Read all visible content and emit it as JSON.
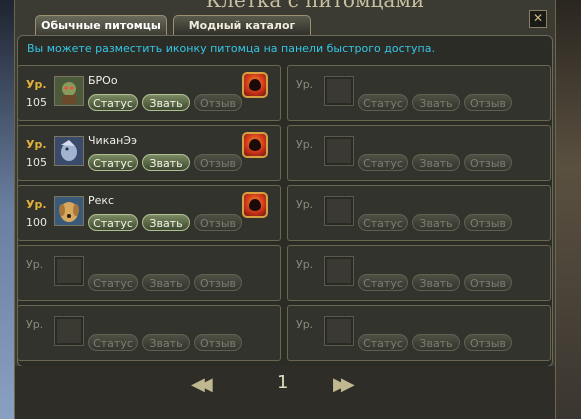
{
  "window": {
    "title": "Клетка с питомцами",
    "close_icon": "close-icon"
  },
  "tabs": [
    {
      "label": "Обычные питомцы",
      "active": true
    },
    {
      "label": "Модный каталог",
      "active": false
    }
  ],
  "info_text": "Вы можете разместить иконку питомца на панели быстрого доступа.",
  "labels": {
    "level": "Ур.",
    "status": "Статус",
    "summon": "Звать",
    "recall": "Отзыв"
  },
  "pets": [
    {
      "name": "БРОо",
      "level": "105",
      "icon": "orc-pet-icon"
    },
    {
      "name": "ЧиканЭэ",
      "level": "105",
      "icon": "bird-pet-icon"
    },
    {
      "name": "Рекс",
      "level": "100",
      "icon": "dog-pet-icon"
    }
  ],
  "pager": {
    "page": "1",
    "prev_icon": "double-left-arrow-icon",
    "next_icon": "double-right-arrow-icon"
  },
  "colors": {
    "info": "#34c7e6",
    "level_label": "#e2b23a",
    "active_button": "#6a7a52"
  }
}
